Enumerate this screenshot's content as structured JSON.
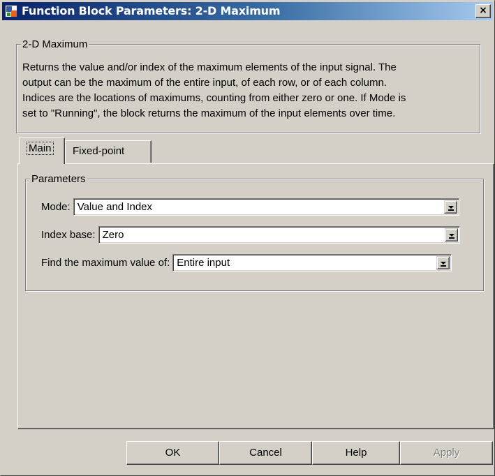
{
  "window": {
    "title": "Function Block Parameters: 2-D Maximum",
    "close_label": "×"
  },
  "description": {
    "group_title": "2-D Maximum",
    "lines": [
      "Returns the value and/or index of the maximum elements of the input signal. The",
      "output can be the maximum of the entire input, of each row, or of each column.",
      "Indices are the locations of maximums, counting from either zero or one. If Mode is",
      "set to \"Running\", the block returns the maximum of the input elements over time."
    ]
  },
  "tabs": [
    {
      "label": "Main",
      "selected": true
    },
    {
      "label": "Fixed-point",
      "selected": false
    }
  ],
  "parameters": {
    "group_title": "Parameters",
    "mode": {
      "label": "Mode:",
      "value": "Value and Index"
    },
    "index_base": {
      "label": "Index base:",
      "value": "Zero"
    },
    "find_max": {
      "label": "Find the maximum value of:",
      "value": "Entire input"
    }
  },
  "buttons": {
    "ok": "OK",
    "cancel": "Cancel",
    "help": "Help",
    "apply": "Apply",
    "apply_enabled": false
  },
  "colors": {
    "titlebar_start": "#0a246a",
    "titlebar_end": "#a6caf0",
    "face": "#d4d0c8"
  }
}
